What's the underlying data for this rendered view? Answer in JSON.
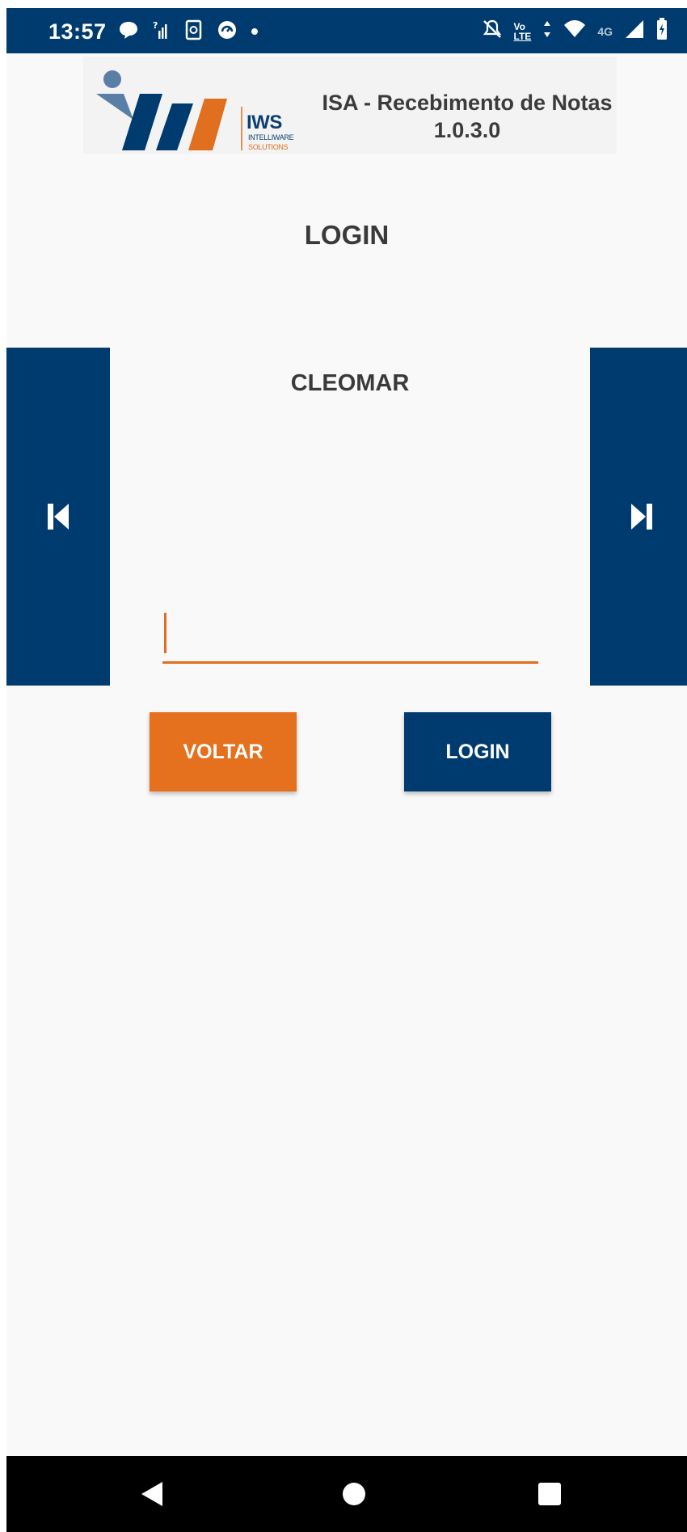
{
  "status_bar": {
    "time": "13:57",
    "left_icons": [
      "chat-bubble-icon",
      "signal-question-icon",
      "phone-sync-icon",
      "gauge-icon",
      "dot-icon"
    ],
    "right_icons": [
      "mute-icon",
      "volte-icon",
      "data-arrows-icon",
      "wifi-icon",
      "4g-icon",
      "signal-icon",
      "battery-icon"
    ],
    "volte_label_1": "Vo",
    "volte_label_2": "LTE",
    "network_label": "4G",
    "background": "#003b6f"
  },
  "header": {
    "logo_text": "IWS",
    "logo_sub_1": "INTELLIWARE",
    "logo_sub_2": "SOLUTIONS",
    "app_title": "ISA - Recebimento de Notas",
    "app_version": "1.0.3.0"
  },
  "page": {
    "title": "LOGIN",
    "user_name": "CLEOMAR",
    "password_value": "",
    "prev_icon": "skip-previous-icon",
    "next_icon": "skip-next-icon"
  },
  "buttons": {
    "back_label": "VOLTAR",
    "login_label": "LOGIN"
  },
  "nav_bar": {
    "icons": [
      "back-triangle-icon",
      "home-circle-icon",
      "recents-square-icon"
    ]
  },
  "colors": {
    "primary_blue": "#003b6f",
    "accent_orange": "#e5701e",
    "background": "#f9f9f9"
  }
}
